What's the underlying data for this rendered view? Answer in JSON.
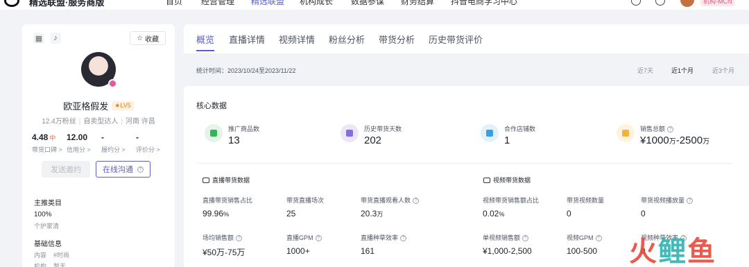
{
  "topnav": {
    "brand": "精选联盟·服务商版",
    "items": [
      "首页",
      "经营管理",
      "精选联盟",
      "机构成长",
      "数据参谋",
      "财务结算",
      "抖音电商学习中心"
    ],
    "active_index": 2,
    "org_tag": "机构-MCN"
  },
  "profile": {
    "favorite_label": "收藏",
    "name": "欧亚格假发",
    "level": "LV5",
    "fans": "12.4万粉丝",
    "type": "自卖型达人",
    "location": "河南 许昌",
    "stats": [
      {
        "value": "4.48",
        "tag": "中",
        "label": "带货口碑 >"
      },
      {
        "value": "12.00",
        "tag": "",
        "label": "信用分 >"
      },
      {
        "value": "-",
        "tag": "",
        "label": "履约分 >"
      },
      {
        "value": "-",
        "tag": "",
        "label": "评价分 >"
      }
    ],
    "invite_button": "发送邀约",
    "chat_button": "在线沟通",
    "main_category_title": "主推类目",
    "main_category_value": "100%",
    "main_category_name": "个护家清",
    "basic_info_title": "基础信息",
    "content_label": "内容",
    "content_value": "#时尚",
    "org_label": "机构",
    "org_value": "暂无"
  },
  "tabs": [
    "概览",
    "直播详情",
    "视频详情",
    "粉丝分析",
    "带货分析",
    "历史带货评价"
  ],
  "active_tab": 0,
  "period": {
    "text": "统计时间：2023/10/24至2023/11/22",
    "options": [
      "近7天",
      "近1个月",
      "近3个月"
    ],
    "active_option": 1
  },
  "core": {
    "title": "核心数据",
    "metrics": [
      {
        "label": "推广商品数",
        "value": "13",
        "color": "#35b35a"
      },
      {
        "label": "历史带货天数",
        "value": "202",
        "color": "#8a6de0"
      },
      {
        "label": "合作店铺数",
        "value": "1",
        "color": "#3aa0e0"
      },
      {
        "label": "销售总额",
        "value_a": "¥1000",
        "unit_a": "万",
        "value_b": "-2500",
        "unit_b": "万",
        "color": "#f2b53c"
      }
    ],
    "live_title": "直播带货数据",
    "video_title": "视频带货数据",
    "live": [
      {
        "label": "直播带货销售占比",
        "value": "99.96",
        "unit": "%"
      },
      {
        "label": "带货直播场次",
        "value": "25",
        "unit": ""
      },
      {
        "label": "带货直播观看人数",
        "value": "20.3",
        "unit": "万"
      },
      {
        "label": "场均销售额",
        "value": "¥50万-75万",
        "unit": ""
      },
      {
        "label": "直播GPM",
        "value": "1000+",
        "unit": ""
      },
      {
        "label": "直播种草效率",
        "value": "161",
        "unit": ""
      }
    ],
    "video": [
      {
        "label": "视频带货销售额占比",
        "value": "0.02",
        "unit": "%"
      },
      {
        "label": "带货视频数量",
        "value": "0",
        "unit": ""
      },
      {
        "label": "带货视频播放量",
        "value": "0",
        "unit": ""
      },
      {
        "label": "单视频销售额",
        "value": "¥1,000-2,500",
        "unit": ""
      },
      {
        "label": "视频GPM",
        "value": "100-500",
        "unit": ""
      },
      {
        "label": "视频种草效率",
        "value": "0",
        "unit": ""
      }
    ]
  },
  "watermark": {
    "w1": "火",
    "w2": "鲤",
    "w3": "鱼"
  }
}
